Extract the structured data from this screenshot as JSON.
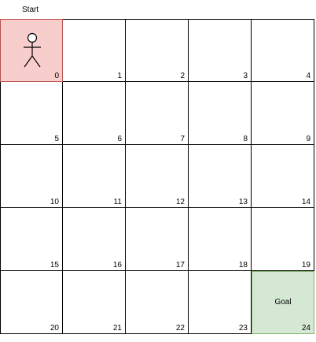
{
  "start_label": "Start",
  "goal_label": "Goal",
  "grid": {
    "rows": 5,
    "cols": 5,
    "start_cell": 0,
    "goal_cell": 24,
    "cells": [
      "0",
      "1",
      "2",
      "3",
      "4",
      "5",
      "6",
      "7",
      "8",
      "9",
      "10",
      "11",
      "12",
      "13",
      "14",
      "15",
      "16",
      "17",
      "18",
      "19",
      "20",
      "21",
      "22",
      "23",
      "24"
    ]
  },
  "colors": {
    "start_fill": "#f8cecc",
    "start_border": "#b85450",
    "goal_fill": "#d5e8d4",
    "goal_border": "#82b366",
    "grid_line": "#000000"
  },
  "icons": {
    "agent": "stick-figure-icon"
  }
}
